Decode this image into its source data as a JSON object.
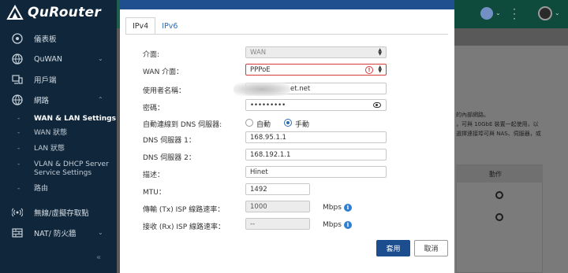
{
  "app": {
    "logo_text": "QuRouter"
  },
  "sidebar": {
    "items": [
      {
        "label": "儀表板",
        "icon": "dashboard-icon"
      },
      {
        "label": "QuWAN",
        "icon": "globe-network-icon"
      },
      {
        "label": "用戶端",
        "icon": "devices-icon"
      },
      {
        "label": "網路",
        "icon": "globe-icon"
      }
    ],
    "sub_items": [
      {
        "label": "WAN & LAN Settings"
      },
      {
        "label": "WAN 狀態"
      },
      {
        "label": "LAN 狀態"
      },
      {
        "label": "VLAN & DHCP Server Service Settings"
      },
      {
        "label": "路由"
      }
    ],
    "items_bottom": [
      {
        "label": "無線/虛擬存取點",
        "icon": "wireless-icon"
      },
      {
        "label": "NAT/ 防火牆",
        "icon": "firewall-icon"
      }
    ]
  },
  "modal": {
    "tabs": [
      "IPv4",
      "IPv6"
    ],
    "fields": {
      "interface": {
        "label": "介面:",
        "value": "WAN"
      },
      "wan_interface": {
        "label": "WAN 介面：",
        "value": "PPPoE"
      },
      "username": {
        "label": "使用者名稱：",
        "value": "et.net"
      },
      "password": {
        "label": "密碼：",
        "value": "•••••••••"
      },
      "auto_dns": {
        "label": "自動連線到 DNS 伺服器:",
        "option_auto": "自動",
        "option_manual": "手動",
        "selected": "手動"
      },
      "dns1": {
        "label": "DNS 伺服器 1：",
        "value": "168.95.1.1"
      },
      "dns2": {
        "label": "DNS 伺服器 2：",
        "value": "168.192.1.1"
      },
      "description": {
        "label": "描述：",
        "value": "Hinet"
      },
      "mtu": {
        "label": "MTU：",
        "value": "1492"
      },
      "tx_rate": {
        "label": "傳輸 (Tx) ISP 線路速率：",
        "value": "1000",
        "unit": "Mbps"
      },
      "rx_rate": {
        "label": "接收 (Rx) ISP 線路速率：",
        "value": "--",
        "unit": "Mbps"
      }
    },
    "buttons": {
      "apply": "套用",
      "cancel": "取消"
    }
  },
  "background": {
    "text_lines": [
      "的內部網路。",
      "，可與 10GbE 裝置一起使用，以",
      "選擇連接埠可與 NAS、伺服器，或"
    ],
    "table_header": "動作"
  },
  "colors": {
    "sidebar_bg": "#10273b",
    "accent": "#1c4d8f",
    "error": "#d33a3a",
    "link": "#2b6cb0"
  }
}
